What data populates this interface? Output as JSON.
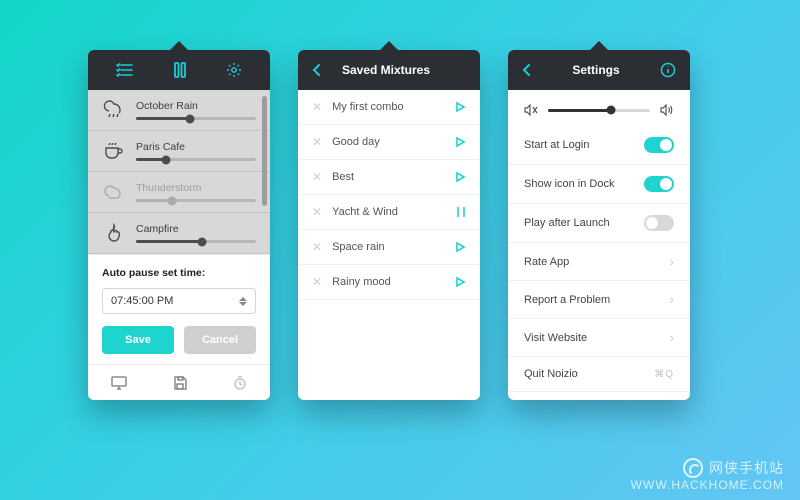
{
  "colors": {
    "accent": "#18cfd6",
    "header": "#2b2f33"
  },
  "panel1": {
    "tabs": [
      "list",
      "pause",
      "settings"
    ],
    "sounds": [
      {
        "name": "October Rain",
        "icon": "cloud-rain",
        "active": true,
        "level": 0.45
      },
      {
        "name": "Paris Cafe",
        "icon": "coffee-cup",
        "active": true,
        "level": 0.25
      },
      {
        "name": "Thunderstorm",
        "icon": "cloud",
        "active": false,
        "level": 0.3
      },
      {
        "name": "Campfire",
        "icon": "fire",
        "active": true,
        "level": 0.55
      }
    ],
    "auto_pause": {
      "label": "Auto pause set time:",
      "time": "07:45:00 PM",
      "save_label": "Save",
      "cancel_label": "Cancel"
    },
    "footer_icons": [
      "display",
      "save-disk",
      "timer"
    ]
  },
  "panel2": {
    "title": "Saved Mixtures",
    "items": [
      {
        "name": "My first combo",
        "state": "play"
      },
      {
        "name": "Good day",
        "state": "play"
      },
      {
        "name": "Best",
        "state": "play"
      },
      {
        "name": "Yacht & Wind",
        "state": "pause"
      },
      {
        "name": "Space rain",
        "state": "play"
      },
      {
        "name": "Rainy mood",
        "state": "play"
      }
    ]
  },
  "panel3": {
    "title": "Settings",
    "master_volume": 0.62,
    "rows": [
      {
        "label": "Start at Login",
        "type": "toggle",
        "value": true
      },
      {
        "label": "Show icon in Dock",
        "type": "toggle",
        "value": true
      },
      {
        "label": "Play after Launch",
        "type": "toggle",
        "value": false
      },
      {
        "label": "Rate App",
        "type": "link"
      },
      {
        "label": "Report a Problem",
        "type": "link"
      },
      {
        "label": "Visit Website",
        "type": "link"
      },
      {
        "label": "Quit Noizio",
        "type": "shortcut",
        "value": "⌘Q"
      }
    ]
  },
  "watermark": {
    "cn": "网侠手机站",
    "url": "WWW.HACKHOME.COM"
  }
}
